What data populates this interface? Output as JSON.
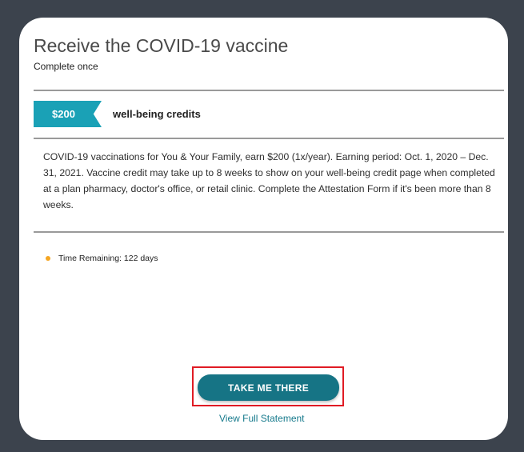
{
  "card": {
    "title": "Receive the COVID-19 vaccine",
    "subtitle": "Complete once",
    "credit": {
      "amount": "$200",
      "label": "well-being credits"
    },
    "description": "COVID-19 vaccinations for You & Your Family, earn $200 (1x/year). Earning period: Oct. 1, 2020 – Dec. 31, 2021. Vaccine credit may take up to 8 weeks to show on your well-being credit page when completed at a plan pharmacy, doctor's office, or retail clinic. Complete the Attestation Form if it's been more than 8 weeks.",
    "status": {
      "text": "Time Remaining: 122 days"
    },
    "primary_button_label": "TAKE ME THERE",
    "secondary_link_label": "View Full Statement"
  },
  "colors": {
    "background": "#3c434d",
    "accent": "#1aa1b6",
    "button": "#167485",
    "status_dot": "#f5a623",
    "highlight": "#e01b24"
  }
}
